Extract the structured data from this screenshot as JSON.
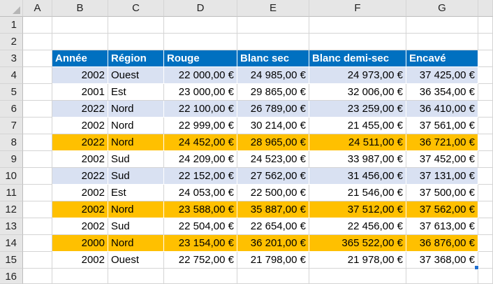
{
  "columns": [
    "A",
    "B",
    "C",
    "D",
    "E",
    "F",
    "G"
  ],
  "row_numbers": [
    "1",
    "2",
    "3",
    "4",
    "5",
    "6",
    "7",
    "8",
    "9",
    "10",
    "11",
    "12",
    "13",
    "14",
    "15",
    "16"
  ],
  "table": {
    "headers": [
      "Année",
      "Région",
      "Rouge",
      "Blanc sec",
      "Blanc demi-sec",
      "Encavé"
    ],
    "rows": [
      [
        "2002",
        "Ouest",
        "22 000,00 €",
        "24 985,00 €",
        "24 973,00 €",
        "37 425,00 €"
      ],
      [
        "2001",
        "Est",
        "23 000,00 €",
        "29 865,00 €",
        "32 006,00 €",
        "36 354,00 €"
      ],
      [
        "2022",
        "Nord",
        "22 100,00 €",
        "26 789,00 €",
        "23 259,00 €",
        "36 410,00 €"
      ],
      [
        "2002",
        "Nord",
        "22 999,00 €",
        "30 214,00 €",
        "21 455,00 €",
        "37 561,00 €"
      ],
      [
        "2022",
        "Nord",
        "24 452,00 €",
        "28 965,00 €",
        "24 511,00 €",
        "36 721,00 €"
      ],
      [
        "2002",
        "Sud",
        "24 209,00 €",
        "24 523,00 €",
        "33 987,00 €",
        "37 452,00 €"
      ],
      [
        "2022",
        "Sud",
        "22 152,00 €",
        "27 562,00 €",
        "31 456,00 €",
        "37 131,00 €"
      ],
      [
        "2002",
        "Est",
        "24 053,00 €",
        "22 500,00 €",
        "21 546,00 €",
        "37 500,00 €"
      ],
      [
        "2002",
        "Nord",
        "23 588,00 €",
        "35 887,00 €",
        "37 512,00 €",
        "37 562,00 €"
      ],
      [
        "2002",
        "Sud",
        "22 504,00 €",
        "22 654,00 €",
        "22 456,00 €",
        "37 613,00 €"
      ],
      [
        "2000",
        "Nord",
        "23 154,00 €",
        "36 201,00 €",
        "365 522,00 €",
        "36 876,00 €"
      ],
      [
        "2002",
        "Ouest",
        "22 752,00 €",
        "21 798,00 €",
        "21 978,00 €",
        "37 368,00 €"
      ]
    ],
    "row_styles": [
      "band",
      "plain",
      "band",
      "plain",
      "hl",
      "plain",
      "band",
      "plain",
      "hl",
      "plain",
      "hl",
      "plain"
    ]
  },
  "colors": {
    "header_blue": "#0070c0",
    "band_blue": "#d9e1f2",
    "highlight_orange": "#ffc000"
  }
}
